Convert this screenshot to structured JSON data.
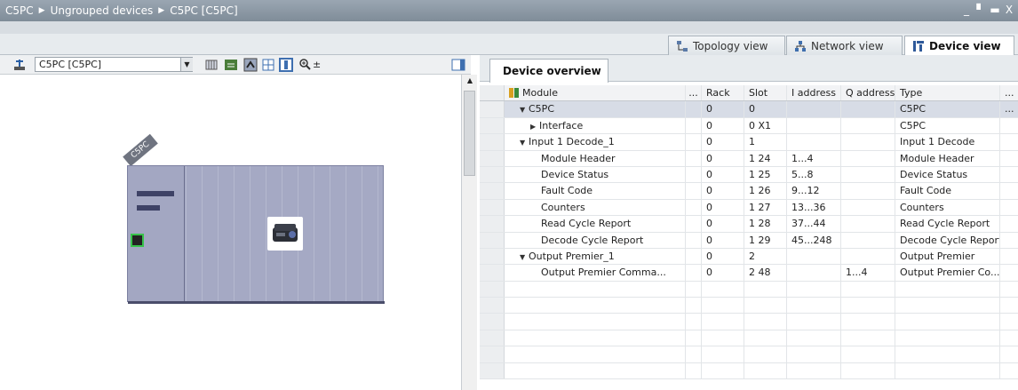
{
  "title_bar": {
    "breadcrumb": [
      "C5PC",
      "Ungrouped devices",
      "C5PC [C5PC]"
    ],
    "window_buttons": [
      "_",
      "▘",
      "▬",
      "X"
    ]
  },
  "view_tabs": [
    {
      "label": "Topology view",
      "icon": "topology-icon",
      "active": false
    },
    {
      "label": "Network view",
      "icon": "network-icon",
      "active": false
    },
    {
      "label": "Device view",
      "icon": "device-icon",
      "active": true
    }
  ],
  "left_toolbar": {
    "device_selector_value": "C5PC [C5PC]",
    "icons": [
      "network-pin-icon",
      "rack-icon",
      "properties-icon",
      "monitor-icon",
      "grid-icon",
      "columns-icon",
      "zoom-icon"
    ]
  },
  "canvas": {
    "rack_label": "C5PC",
    "device_image": "scanner-device-icon"
  },
  "overview": {
    "tab_label": "Device overview",
    "columns": [
      "Module",
      "...",
      "Rack",
      "Slot",
      "I address",
      "Q address",
      "Type",
      "..."
    ],
    "rows": [
      {
        "module": "C5PC",
        "indent": 1,
        "expander": "down",
        "rack": "0",
        "slot": "0",
        "iaddr": "",
        "qaddr": "",
        "type": "C5PC",
        "tail": "...",
        "selected": true
      },
      {
        "module": "Interface",
        "indent": 2,
        "expander": "right",
        "rack": "0",
        "slot": "0 X1",
        "iaddr": "",
        "qaddr": "",
        "type": "C5PC",
        "tail": "",
        "selected": false
      },
      {
        "module": "Input 1 Decode_1",
        "indent": 1,
        "expander": "down",
        "rack": "0",
        "slot": "1",
        "iaddr": "",
        "qaddr": "",
        "type": "Input 1 Decode",
        "tail": "",
        "selected": false
      },
      {
        "module": "Module Header",
        "indent": 3,
        "expander": "",
        "rack": "0",
        "slot": "1 24",
        "iaddr": "1...4",
        "qaddr": "",
        "type": "Module Header",
        "tail": "",
        "selected": false
      },
      {
        "module": "Device Status",
        "indent": 3,
        "expander": "",
        "rack": "0",
        "slot": "1 25",
        "iaddr": "5...8",
        "qaddr": "",
        "type": "Device Status",
        "tail": "",
        "selected": false
      },
      {
        "module": "Fault Code",
        "indent": 3,
        "expander": "",
        "rack": "0",
        "slot": "1 26",
        "iaddr": "9...12",
        "qaddr": "",
        "type": "Fault Code",
        "tail": "",
        "selected": false
      },
      {
        "module": "Counters",
        "indent": 3,
        "expander": "",
        "rack": "0",
        "slot": "1 27",
        "iaddr": "13...36",
        "qaddr": "",
        "type": "Counters",
        "tail": "",
        "selected": false
      },
      {
        "module": "Read Cycle Report",
        "indent": 3,
        "expander": "",
        "rack": "0",
        "slot": "1 28",
        "iaddr": "37...44",
        "qaddr": "",
        "type": "Read Cycle Report",
        "tail": "",
        "selected": false
      },
      {
        "module": "Decode Cycle Report",
        "indent": 3,
        "expander": "",
        "rack": "0",
        "slot": "1 29",
        "iaddr": "45...248",
        "qaddr": "",
        "type": "Decode Cycle Report",
        "tail": "",
        "selected": false
      },
      {
        "module": "Output Premier_1",
        "indent": 1,
        "expander": "down",
        "rack": "0",
        "slot": "2",
        "iaddr": "",
        "qaddr": "",
        "type": "Output Premier",
        "tail": "",
        "selected": false
      },
      {
        "module": "Output Premier Comma...",
        "indent": 3,
        "expander": "",
        "rack": "0",
        "slot": "2 48",
        "iaddr": "",
        "qaddr": "1...4",
        "type": "Output Premier Co...",
        "tail": "",
        "selected": false
      }
    ],
    "empty_rows": 6
  }
}
